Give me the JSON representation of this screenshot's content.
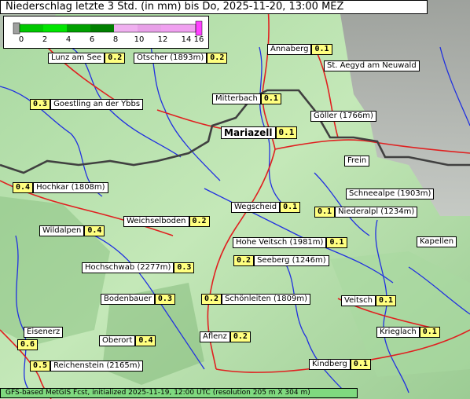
{
  "title": "Niederschlag letzte 3 Std. (in mm) bis Do, 2025-11-20, 13:00 MEZ",
  "legend": {
    "ticks": [
      "0",
      "2",
      "4",
      "6",
      "8",
      "10",
      "12",
      "14",
      "16"
    ],
    "colors": [
      "#a0a0a0",
      "#00c800",
      "#00e600",
      "#00a000",
      "#008000",
      "#f0b0f0",
      "#e8a0e8",
      "#f0a0f0",
      "#ff40ff"
    ]
  },
  "places": [
    {
      "name": "Lunz am See",
      "value": "0.2"
    },
    {
      "name": "Ötscher (1893m)",
      "value": "0.2"
    },
    {
      "name": "Annaberg",
      "value": "0.1"
    },
    {
      "name": "St. Aegyd am Neuwald",
      "value": ""
    },
    {
      "name": "Goestling an der Ybbs",
      "value": "0.3"
    },
    {
      "name": "Mitterbach",
      "value": "0.1"
    },
    {
      "name": "Göller (1766m)",
      "value": ""
    },
    {
      "name": "Mariazell",
      "value": "0.1"
    },
    {
      "name": "Frein",
      "value": ""
    },
    {
      "name": "Hochkar (1808m)",
      "value": "0.4"
    },
    {
      "name": "Schneealpe (1903m)",
      "value": ""
    },
    {
      "name": "Wegscheid",
      "value": "0.1"
    },
    {
      "name": "Niederalpl (1234m)",
      "value": "0.1"
    },
    {
      "name": "Weichselboden",
      "value": "0.2"
    },
    {
      "name": "Wildalpen",
      "value": "0.4"
    },
    {
      "name": "Hohe Veitsch (1981m)",
      "value": "0.1"
    },
    {
      "name": "Kapellen",
      "value": ""
    },
    {
      "name": "Seeberg (1246m)",
      "value": "0.2"
    },
    {
      "name": "Hochschwab (2277m)",
      "value": "0.3"
    },
    {
      "name": "Bodenbauer",
      "value": "0.3"
    },
    {
      "name": "Schönleiten (1809m)",
      "value": "0.2"
    },
    {
      "name": "Veitsch",
      "value": "0.1"
    },
    {
      "name": "Eisenerz",
      "value": "0.6"
    },
    {
      "name": "Oberort",
      "value": "0.4"
    },
    {
      "name": "Aflenz",
      "value": "0.2"
    },
    {
      "name": "Krieglach",
      "value": "0.1"
    },
    {
      "name": "Reichenstein (2165m)",
      "value": "0.5"
    },
    {
      "name": "Kindberg",
      "value": "0.1"
    }
  ],
  "footer": "GFS-based MetGIS Fcst, initialized 2025-11-19, 12:00 UTC  (resolution 205 m X 304 m)"
}
